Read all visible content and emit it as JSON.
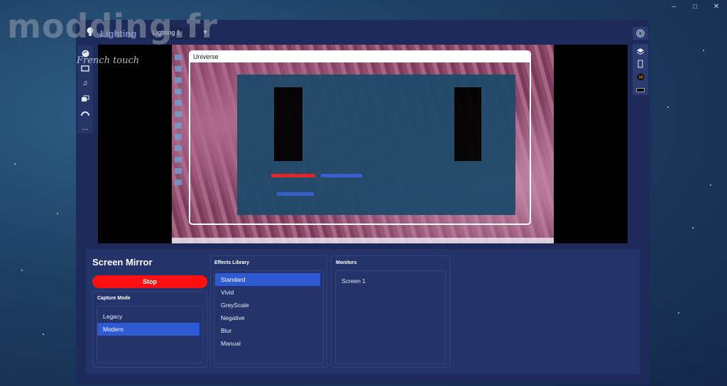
{
  "window_controls": {
    "minimize": "–",
    "maximize": "□",
    "close": "✕"
  },
  "watermark": {
    "main": "modding.fr",
    "sub": "French touch"
  },
  "app": {
    "title": "Lighting",
    "profile_select": {
      "value": "Lighting 1"
    }
  },
  "left_rail": {
    "items": [
      {
        "icon": "palette-icon"
      },
      {
        "icon": "monitor-icon"
      },
      {
        "icon": "music-icon"
      },
      {
        "icon": "screens-icon"
      },
      {
        "icon": "gauge-icon"
      },
      {
        "icon": "more-icon",
        "label": "..."
      }
    ]
  },
  "right_rail": {
    "top_icon": "spiral-icon",
    "items": [
      "layers-icon",
      "device-icon",
      "h-logo-icon",
      "keyboard-icon"
    ]
  },
  "preview": {
    "window_title": "Universe"
  },
  "screen_mirror": {
    "title": "Screen Mirror",
    "stop_label": "Stop",
    "capture_mode": {
      "title": "Capture Mode",
      "options": [
        "Legacy",
        "Modern"
      ],
      "selected": "Modern"
    },
    "effects_library": {
      "title": "Effects Library",
      "options": [
        "Standard",
        "Vivid",
        "GreyScale",
        "Negative",
        "Blur",
        "Manual"
      ],
      "selected": "Standard"
    },
    "monitors": {
      "title": "Monitors",
      "options": [
        "Screen 1"
      ]
    }
  },
  "colors": {
    "accent_blue": "#2e5bd4",
    "stop_red": "#ff0f0f",
    "panel_bg": "#24336a",
    "app_bg": "#1e2b5a"
  }
}
